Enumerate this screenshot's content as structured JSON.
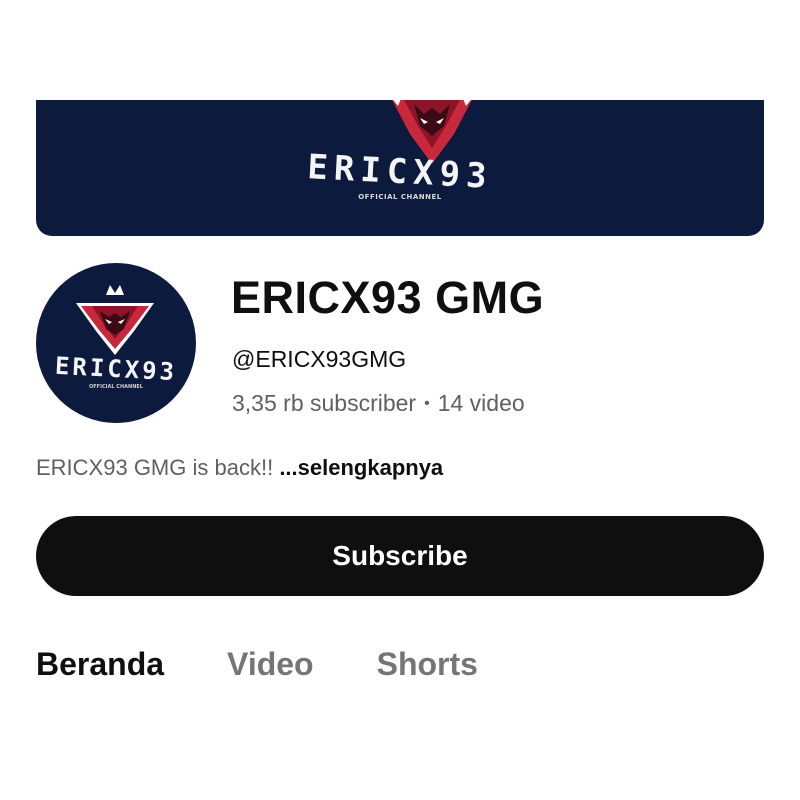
{
  "banner": {
    "brand": "ERICX93",
    "tagline": "OFFICIAL CHANNEL"
  },
  "avatar": {
    "brand": "ERICX93",
    "tagline": "OFFICIAL CHANNEL"
  },
  "channel": {
    "name": "ERICX93 GMG",
    "handle": "@ERICX93GMG",
    "subscribers": "3,35 rb subscriber",
    "separator": "•",
    "videos": "14 video",
    "description": "ERICX93 GMG is back!!",
    "more_label": "...selengkapnya"
  },
  "subscribe": {
    "label": "Subscribe"
  },
  "tabs": [
    {
      "label": "Beranda",
      "active": true
    },
    {
      "label": "Video",
      "active": false
    },
    {
      "label": "Shorts",
      "active": false
    }
  ],
  "colors": {
    "banner_bg": "#0c1a3d",
    "logo_red": "#c8283c",
    "logo_dark_red": "#8e1427",
    "button_bg": "#0f0f0f",
    "muted_text": "#606060"
  },
  "icons": {
    "logo": "wolf-head-icon"
  }
}
